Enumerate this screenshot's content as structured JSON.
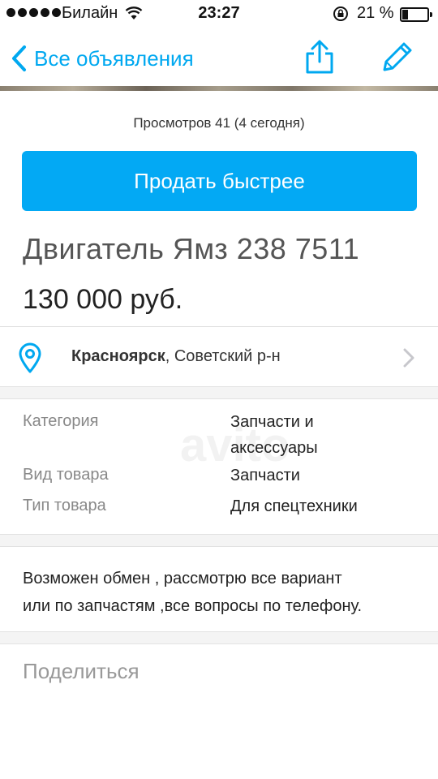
{
  "status_bar": {
    "carrier": "Билайн",
    "time": "23:27",
    "battery_percent": "21 %"
  },
  "nav": {
    "back_label": "Все объявления",
    "icons": [
      "chevron-left-icon",
      "share-icon",
      "pencil-icon"
    ]
  },
  "views": "Просмотров 41 (4 сегодня)",
  "sell_button": "Продать быстрее",
  "ad": {
    "title": "Двигатель Ямз 238 7511",
    "price": "130 000 руб."
  },
  "location": {
    "city": "Красноярск",
    "district": ", Советский р-н"
  },
  "params": [
    {
      "label": "Категория",
      "value_lines": [
        "Запчасти и",
        "аксессуары"
      ]
    },
    {
      "label": "Вид товара",
      "value_lines": [
        "Запчасти"
      ]
    },
    {
      "label": "Тип товара",
      "value_lines": [
        "Для спецтехники"
      ]
    }
  ],
  "description_lines": [
    "Возможен обмен , рассмотрю все вариант",
    "или по запчастям ,все вопросы по телефону."
  ],
  "share": {
    "title": "Поделиться",
    "networks": [
      {
        "name": "vk-icon",
        "color": "#4a76a8"
      },
      {
        "name": "odnoklassniki-icon",
        "color": "#f08d26"
      },
      {
        "name": "facebook-icon",
        "color": "#3b5a9a"
      },
      {
        "name": "twitter-icon",
        "color": "#2ea8e0"
      },
      {
        "name": "google-plus-icon",
        "color": "#dc4a38"
      }
    ]
  },
  "colors": {
    "accent": "#00a8f0",
    "button": "#03a9f4"
  }
}
